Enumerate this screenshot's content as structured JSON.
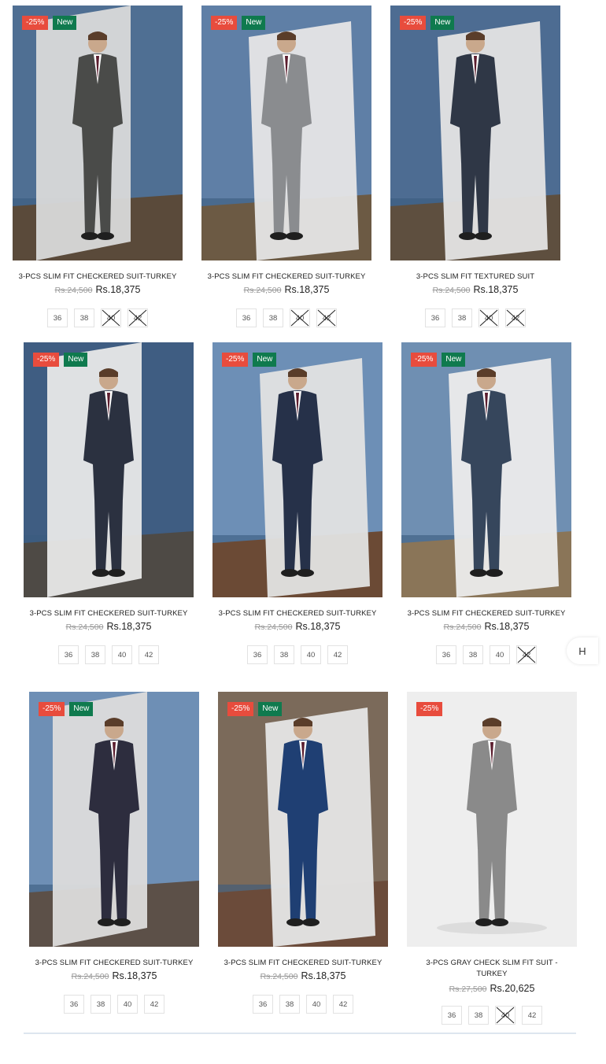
{
  "products": [
    {
      "title": "3-PCS SLIM FIT CHECKERED SUIT-TURKEY",
      "old_price": "Rs.24,500",
      "price": "Rs.18,375",
      "discount": "-25%",
      "badge_new": "New",
      "sizes": [
        {
          "label": "36",
          "sold": false
        },
        {
          "label": "38",
          "sold": false
        },
        {
          "label": "40",
          "sold": true
        },
        {
          "label": "42",
          "sold": true
        }
      ],
      "colors": {
        "sky": "#4f6f93",
        "ground": "#5a4a3a",
        "suit": "#4a4b49",
        "wall": "#d9d9d9"
      }
    },
    {
      "title": "3-PCS SLIM FIT CHECKERED SUIT-TURKEY",
      "old_price": "Rs.24,500",
      "price": "Rs.18,375",
      "discount": "-25%",
      "badge_new": "New",
      "sizes": [
        {
          "label": "36",
          "sold": false
        },
        {
          "label": "38",
          "sold": false
        },
        {
          "label": "40",
          "sold": true
        },
        {
          "label": "42",
          "sold": true
        }
      ],
      "colors": {
        "sky": "#5f7fa6",
        "ground": "#6c5a44",
        "suit": "#8a8c8f",
        "wall": "#e6e6e6"
      }
    },
    {
      "title": "3-PCS SLIM FIT TEXTURED SUIT",
      "old_price": "Rs.24,500",
      "price": "Rs.18,375",
      "discount": "-25%",
      "badge_new": "New",
      "sizes": [
        {
          "label": "36",
          "sold": false
        },
        {
          "label": "38",
          "sold": false
        },
        {
          "label": "40",
          "sold": true
        },
        {
          "label": "42",
          "sold": true
        }
      ],
      "colors": {
        "sky": "#4d6c92",
        "ground": "#5e4f3f",
        "suit": "#2f3746",
        "wall": "#e4e4e4"
      }
    },
    {
      "title": "3-PCS SLIM FIT CHECKERED SUIT-TURKEY",
      "old_price": "Rs.24,500",
      "price": "Rs.18,375",
      "discount": "-25%",
      "badge_new": "New",
      "sizes": [
        {
          "label": "36",
          "sold": false
        },
        {
          "label": "38",
          "sold": false
        },
        {
          "label": "40",
          "sold": false
        },
        {
          "label": "42",
          "sold": false
        }
      ],
      "colors": {
        "sky": "#3f5d82",
        "ground": "#4e4a45",
        "suit": "#2b3140",
        "wall": "#e8e8e8"
      }
    },
    {
      "title": "3-PCS SLIM FIT CHECKERED SUIT-TURKEY",
      "old_price": "Rs.24,500",
      "price": "Rs.18,375",
      "discount": "-25%",
      "badge_new": "New",
      "sizes": [
        {
          "label": "36",
          "sold": false
        },
        {
          "label": "38",
          "sold": false
        },
        {
          "label": "40",
          "sold": false
        },
        {
          "label": "42",
          "sold": false
        }
      ],
      "colors": {
        "sky": "#6d8fb6",
        "ground": "#6b4a35",
        "suit": "#263149",
        "wall": "#e3e3e3"
      }
    },
    {
      "title": "3-PCS SLIM FIT CHECKERED SUIT-TURKEY",
      "old_price": "Rs.24,500",
      "price": "Rs.18,375",
      "discount": "-25%",
      "badge_new": "New",
      "sizes": [
        {
          "label": "36",
          "sold": false
        },
        {
          "label": "38",
          "sold": false
        },
        {
          "label": "40",
          "sold": false
        },
        {
          "label": "42",
          "sold": true
        }
      ],
      "colors": {
        "sky": "#6f8fb2",
        "ground": "#8a7558",
        "suit": "#36465c",
        "wall": "#ececec"
      }
    },
    {
      "title": "3-PCS SLIM FIT CHECKERED SUIT-TURKEY",
      "old_price": "Rs.24,500",
      "price": "Rs.18,375",
      "discount": "-25%",
      "badge_new": "New",
      "sizes": [
        {
          "label": "36",
          "sold": false
        },
        {
          "label": "38",
          "sold": false
        },
        {
          "label": "40",
          "sold": false
        },
        {
          "label": "42",
          "sold": false
        }
      ],
      "colors": {
        "sky": "#6e8fb5",
        "ground": "#5c5048",
        "suit": "#2d2d3e",
        "wall": "#dcdcdc"
      }
    },
    {
      "title": "3-PCS SLIM FIT CHECKERED SUIT-TURKEY",
      "old_price": "Rs.24,500",
      "price": "Rs.18,375",
      "discount": "-25%",
      "badge_new": "New",
      "sizes": [
        {
          "label": "36",
          "sold": false
        },
        {
          "label": "38",
          "sold": false
        },
        {
          "label": "40",
          "sold": false
        },
        {
          "label": "42",
          "sold": false
        }
      ],
      "colors": {
        "sky": "#7b6a5a",
        "ground": "#6b4b3a",
        "suit": "#1f3f73",
        "wall": "#e6e6e6"
      }
    },
    {
      "title": "3-PCS GRAY CHECK SLIM FIT SUIT - TURKEY",
      "old_price": "Rs.27,500",
      "price": "Rs.20,625",
      "discount": "-25%",
      "badge_new": "",
      "sizes": [
        {
          "label": "36",
          "sold": false
        },
        {
          "label": "38",
          "sold": false
        },
        {
          "label": "40",
          "sold": true
        },
        {
          "label": "42",
          "sold": false
        }
      ],
      "colors": {
        "sky": "#eeeeee",
        "ground": "#e9e9e9",
        "suit": "#8a8a8a",
        "wall": "#f1f1f1"
      }
    }
  ],
  "edge_tab": "H"
}
